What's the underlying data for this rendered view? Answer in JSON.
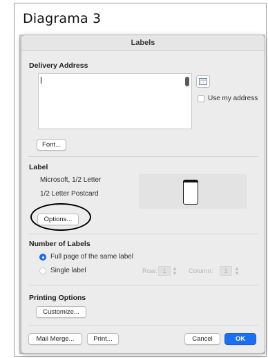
{
  "caption": "Diagrama 3",
  "dialog": {
    "title": "Labels",
    "delivery_address": {
      "heading": "Delivery Address",
      "value": "",
      "use_my_address": "Use my address",
      "use_my_address_checked": false,
      "font_button": "Font..."
    },
    "label": {
      "heading": "Label",
      "vendor": "Microsoft, 1/2 Letter",
      "product": "1/2 Letter Postcard",
      "options_button": "Options..."
    },
    "number_of_labels": {
      "heading": "Number of Labels",
      "full_page": "Full page of the same label",
      "single_label": "Single label",
      "selected": "full_page",
      "row_label": "Row:",
      "row_value": "1",
      "column_label": "Column:",
      "column_value": "1"
    },
    "printing_options": {
      "heading": "Printing Options",
      "customize_button": "Customize..."
    },
    "footer": {
      "mail_merge_button": "Mail Merge...",
      "print_button": "Print...",
      "cancel_button": "Cancel",
      "ok_button": "OK"
    }
  },
  "colors": {
    "accent": "#1c6ef2",
    "dialog_bg": "#ececec",
    "annotation": "#000000"
  },
  "icons": {
    "address_book": "address-book-icon",
    "label_preview": "phone-postcard-icon",
    "stepper": "up-down-stepper-icon"
  }
}
